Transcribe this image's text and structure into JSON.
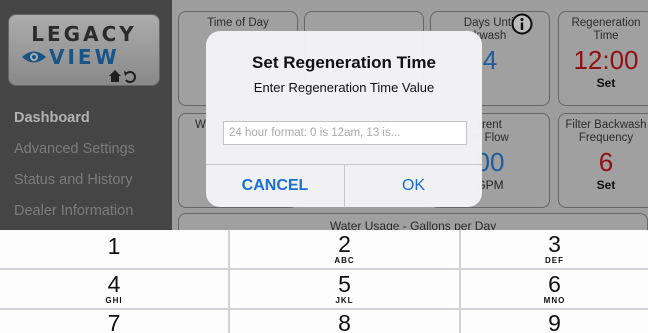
{
  "sidebar": {
    "logo_top": "LEGACY",
    "logo_bottom": "VIEW",
    "nav": [
      "Dashboard",
      "Advanced Settings",
      "Status and History",
      "Dealer Information"
    ]
  },
  "tiles": {
    "time_of_day": {
      "label": "Time of Day"
    },
    "days_backwash": {
      "label_line1": "Days Until",
      "label_line2": "kwash",
      "value": "4"
    },
    "regen_time": {
      "label_line1": "Regeneration",
      "label_line2": "Time",
      "value": "12:00",
      "action": "Set"
    },
    "row2_left": {
      "label": "W"
    },
    "current_flow": {
      "label_line1": "rrent",
      "label_line2": "er Flow",
      "value": "00",
      "unit": "GPM"
    },
    "filter_backwash": {
      "label_line1": "Filter Backwash",
      "label_line2": "Frequency",
      "value": "6",
      "action": "Set"
    },
    "water_usage": {
      "label": "Water Usage - Gallons per Day"
    }
  },
  "alert": {
    "title": "Set Regeneration Time",
    "message": "Enter Regeneration Time Value",
    "input_placeholder": "24 hour format: 0 is 12am, 13 is...",
    "input_value": "",
    "cancel_label": "CANCEL",
    "ok_label": "OK"
  },
  "keypad": {
    "keys": [
      {
        "digit": "1",
        "letters": ""
      },
      {
        "digit": "2",
        "letters": "ABC"
      },
      {
        "digit": "3",
        "letters": "DEF"
      },
      {
        "digit": "4",
        "letters": "GHI"
      },
      {
        "digit": "5",
        "letters": "JKL"
      },
      {
        "digit": "6",
        "letters": "MNO"
      },
      {
        "digit": "7",
        "letters": ""
      },
      {
        "digit": "8",
        "letters": ""
      },
      {
        "digit": "9",
        "letters": ""
      }
    ]
  },
  "colors": {
    "accent_blue": "#1a6fd6",
    "value_red": "#c4161c",
    "value_blue": "#2a7bd4",
    "sidebar_bg": "#5e5e5e"
  }
}
